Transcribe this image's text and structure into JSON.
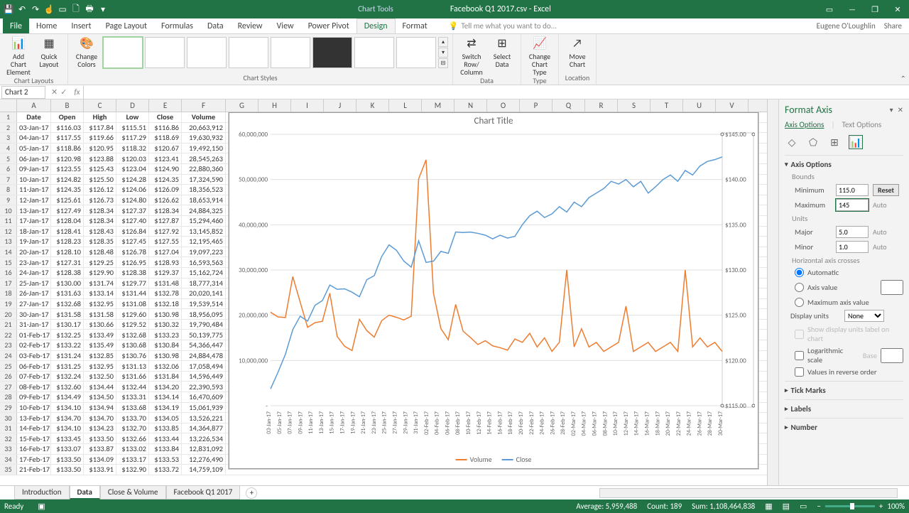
{
  "app": {
    "filename": "Facebook Q1 2017.csv - Excel",
    "context_tab": "Chart Tools",
    "user": "Eugene O'Loughlin",
    "share": "Share"
  },
  "qat": [
    "save",
    "undo",
    "redo",
    "touch",
    "new",
    "open",
    "quick-print",
    "more"
  ],
  "tabs": [
    "File",
    "Home",
    "Insert",
    "Page Layout",
    "Formulas",
    "Data",
    "Review",
    "View",
    "Power Pivot",
    "Design",
    "Format"
  ],
  "active_tab": "Design",
  "tellme": "Tell me what you want to do...",
  "ribbon": {
    "layouts": {
      "add": "Add Chart Element",
      "quick": "Quick Layout",
      "label": "Chart Layouts"
    },
    "colors": {
      "btn": "Change Colors",
      "styles_label": "Chart Styles"
    },
    "data": {
      "switch": "Switch Row/ Column",
      "select": "Select Data",
      "label": "Data"
    },
    "type": {
      "change": "Change Chart Type",
      "label": "Type"
    },
    "location": {
      "move": "Move Chart",
      "label": "Location"
    }
  },
  "namebox": "Chart 2",
  "columns": [
    "A",
    "B",
    "C",
    "D",
    "E",
    "F",
    "G",
    "H",
    "I",
    "J",
    "K",
    "L",
    "M",
    "N",
    "O",
    "P",
    "Q",
    "R",
    "S",
    "T",
    "U",
    "V"
  ],
  "col_widths": {
    "A": 48,
    "B": 46,
    "C": 46,
    "D": 46,
    "E": 46,
    "F": 62,
    "rest": 46
  },
  "headers": [
    "Date",
    "Open",
    "High",
    "Low",
    "Close",
    "Volume"
  ],
  "rows": [
    [
      "03-Jan-17",
      "$116.03",
      "$117.84",
      "$115.51",
      "$116.86",
      "20,663,912"
    ],
    [
      "04-Jan-17",
      "$117.55",
      "$119.66",
      "$117.29",
      "$118.69",
      "19,630,932"
    ],
    [
      "05-Jan-17",
      "$118.86",
      "$120.95",
      "$118.32",
      "$120.67",
      "19,492,150"
    ],
    [
      "06-Jan-17",
      "$120.98",
      "$123.88",
      "$120.03",
      "$123.41",
      "28,545,263"
    ],
    [
      "09-Jan-17",
      "$123.55",
      "$125.43",
      "$123.04",
      "$124.90",
      "22,880,360"
    ],
    [
      "10-Jan-17",
      "$124.82",
      "$125.50",
      "$124.28",
      "$124.35",
      "17,324,590"
    ],
    [
      "11-Jan-17",
      "$124.35",
      "$126.12",
      "$124.06",
      "$126.09",
      "18,356,523"
    ],
    [
      "12-Jan-17",
      "$125.61",
      "$126.73",
      "$124.80",
      "$126.62",
      "18,653,914"
    ],
    [
      "13-Jan-17",
      "$127.49",
      "$128.34",
      "$127.37",
      "$128.34",
      "24,884,325"
    ],
    [
      "17-Jan-17",
      "$128.04",
      "$128.34",
      "$127.40",
      "$127.87",
      "15,294,460"
    ],
    [
      "18-Jan-17",
      "$128.41",
      "$128.43",
      "$126.84",
      "$127.92",
      "13,145,852"
    ],
    [
      "19-Jan-17",
      "$128.23",
      "$128.35",
      "$127.45",
      "$127.55",
      "12,195,465"
    ],
    [
      "20-Jan-17",
      "$128.10",
      "$128.48",
      "$126.78",
      "$127.04",
      "19,097,223"
    ],
    [
      "23-Jan-17",
      "$127.31",
      "$129.25",
      "$126.95",
      "$128.93",
      "16,593,563"
    ],
    [
      "24-Jan-17",
      "$128.38",
      "$129.90",
      "$128.38",
      "$129.37",
      "15,162,724"
    ],
    [
      "25-Jan-17",
      "$130.00",
      "$131.74",
      "$129.77",
      "$131.48",
      "18,777,314"
    ],
    [
      "26-Jan-17",
      "$131.63",
      "$133.14",
      "$131.44",
      "$132.78",
      "20,020,141"
    ],
    [
      "27-Jan-17",
      "$132.68",
      "$132.95",
      "$131.08",
      "$132.18",
      "19,539,514"
    ],
    [
      "30-Jan-17",
      "$131.58",
      "$131.58",
      "$129.60",
      "$130.98",
      "18,956,095"
    ],
    [
      "31-Jan-17",
      "$130.17",
      "$130.66",
      "$129.52",
      "$130.32",
      "19,790,484"
    ],
    [
      "01-Feb-17",
      "$132.25",
      "$133.49",
      "$132.68",
      "$133.23",
      "50,139,775"
    ],
    [
      "02-Feb-17",
      "$133.22",
      "$135.49",
      "$130.68",
      "$130.84",
      "54,366,447"
    ],
    [
      "03-Feb-17",
      "$131.24",
      "$132.85",
      "$130.76",
      "$130.98",
      "24,884,478"
    ],
    [
      "06-Feb-17",
      "$131.25",
      "$132.95",
      "$131.13",
      "$132.06",
      "17,058,494"
    ],
    [
      "07-Feb-17",
      "$132.24",
      "$132.50",
      "$131.66",
      "$131.84",
      "14,596,449"
    ],
    [
      "08-Feb-17",
      "$132.60",
      "$134.44",
      "$132.44",
      "$134.20",
      "22,390,593"
    ],
    [
      "09-Feb-17",
      "$134.49",
      "$134.50",
      "$133.31",
      "$134.14",
      "16,470,609"
    ],
    [
      "10-Feb-17",
      "$134.10",
      "$134.94",
      "$133.68",
      "$134.19",
      "15,061,939"
    ],
    [
      "13-Feb-17",
      "$134.70",
      "$134.70",
      "$133.70",
      "$134.05",
      "13,526,221"
    ],
    [
      "14-Feb-17",
      "$134.10",
      "$134.23",
      "$132.70",
      "$133.85",
      "14,364,877"
    ],
    [
      "15-Feb-17",
      "$133.45",
      "$133.50",
      "$132.66",
      "$133.44",
      "13,226,534"
    ],
    [
      "16-Feb-17",
      "$133.07",
      "$133.87",
      "$133.02",
      "$133.84",
      "12,831,092"
    ],
    [
      "17-Feb-17",
      "$133.50",
      "$134.09",
      "$133.17",
      "$133.53",
      "12,276,490"
    ],
    [
      "21-Feb-17",
      "$133.50",
      "$133.91",
      "$132.90",
      "$133.72",
      "14,759,109"
    ]
  ],
  "chart": {
    "title": "Chart Title",
    "legend": [
      "Volume",
      "Close"
    ]
  },
  "chart_data": {
    "type": "line",
    "title": "Chart Title",
    "x_categories": [
      "03-Jan-17",
      "05-Jan-17",
      "07-Jan-17",
      "09-Jan-17",
      "11-Jan-17",
      "13-Jan-17",
      "15-Jan-17",
      "17-Jan-17",
      "19-Jan-17",
      "21-Jan-17",
      "23-Jan-17",
      "25-Jan-17",
      "27-Jan-17",
      "29-Jan-17",
      "31-Jan-17",
      "02-Feb-17",
      "04-Feb-17",
      "06-Feb-17",
      "08-Feb-17",
      "10-Feb-17",
      "12-Feb-17",
      "14-Feb-17",
      "16-Feb-17",
      "18-Feb-17",
      "20-Feb-17",
      "22-Feb-17",
      "24-Feb-17",
      "26-Feb-17",
      "28-Feb-17",
      "02-Mar-17",
      "04-Mar-17",
      "06-Mar-17",
      "08-Mar-17",
      "10-Mar-17",
      "12-Mar-17",
      "14-Mar-17",
      "16-Mar-17",
      "18-Mar-17",
      "20-Mar-17",
      "22-Mar-17",
      "24-Mar-17",
      "26-Mar-17",
      "28-Mar-17",
      "30-Mar-17"
    ],
    "primary_axis": {
      "label": "Volume",
      "min": 0,
      "max": 60000000,
      "major": 10000000,
      "ticks": [
        "-",
        "10,000,000",
        "20,000,000",
        "30,000,000",
        "40,000,000",
        "50,000,000",
        "60,000,000"
      ]
    },
    "secondary_axis": {
      "label": "Close",
      "min": 115,
      "max": 145,
      "major": 5,
      "ticks": [
        "$115.00",
        "$120.00",
        "$125.00",
        "$130.00",
        "$135.00",
        "$140.00",
        "$145.00"
      ]
    },
    "series": [
      {
        "name": "Volume",
        "axis": "primary",
        "color": "#ED7D31",
        "values": [
          20663912,
          19630932,
          19492150,
          28545263,
          22880360,
          17324590,
          18356523,
          18653914,
          24884325,
          15294460,
          13145852,
          12195465,
          19097223,
          16593563,
          15162724,
          18777314,
          20020141,
          19539514,
          18956095,
          19790484,
          50139775,
          54366447,
          24884478,
          17058494,
          14596449,
          22390593,
          16470609,
          15061939,
          13526221,
          14364877,
          13226534,
          12831092,
          12276490,
          14759109,
          14000000,
          16000000,
          13000000,
          15000000,
          12000000,
          14000000,
          30000000,
          13000000,
          17000000,
          13000000,
          14000000,
          12000000,
          13000000,
          14000000,
          22000000,
          12000000,
          13000000,
          14000000,
          12000000,
          13000000,
          14000000,
          12000000,
          30000000,
          13000000,
          15000000,
          13000000,
          14000000,
          12000000
        ]
      },
      {
        "name": "Close",
        "axis": "secondary",
        "color": "#5B9BD5",
        "values": [
          116.86,
          118.69,
          120.67,
          123.41,
          124.9,
          124.35,
          126.09,
          126.62,
          128.34,
          127.87,
          127.92,
          127.55,
          127.04,
          128.93,
          129.37,
          131.48,
          132.78,
          132.18,
          130.98,
          130.32,
          133.23,
          130.84,
          130.98,
          132.06,
          131.84,
          134.2,
          134.14,
          134.19,
          134.05,
          133.85,
          133.44,
          133.84,
          133.53,
          133.72,
          135.0,
          136.0,
          136.5,
          135.8,
          136.2,
          137.0,
          136.4,
          137.5,
          137.0,
          138.0,
          138.5,
          139.0,
          139.8,
          139.5,
          140.0,
          139.2,
          139.8,
          138.5,
          139.2,
          140.0,
          140.5,
          139.8,
          141.0,
          140.5,
          141.5,
          142.0,
          142.2,
          142.5
        ]
      }
    ]
  },
  "pane": {
    "title": "Format Axis",
    "tabs": [
      "Axis Options",
      "Text Options"
    ],
    "sections": {
      "axis_options": "Axis Options",
      "bounds": "Bounds",
      "min_l": "Minimum",
      "min_v": "115.0",
      "min_btn": "Reset",
      "max_l": "Maximum",
      "max_v": "145",
      "max_btn": "Auto",
      "units": "Units",
      "major_l": "Major",
      "major_v": "5.0",
      "major_btn": "Auto",
      "minor_l": "Minor",
      "minor_v": "1.0",
      "minor_btn": "Auto",
      "crosses": "Horizontal axis crosses",
      "auto": "Automatic",
      "axisval": "Axis value",
      "maxval": "Maximum axis value",
      "display_units": "Display units",
      "display_sel": "None",
      "show_label": "Show display units label on chart",
      "log": "Logarithmic scale",
      "base": "Base",
      "reverse": "Values in reverse order",
      "tick": "Tick Marks",
      "labels": "Labels",
      "number": "Number"
    }
  },
  "worksheets": [
    "Introduction",
    "Data",
    "Close & Volume",
    "Facebook Q1 2017"
  ],
  "active_ws": "Data",
  "status": {
    "ready": "Ready",
    "avg": "Average: 5,959,488",
    "count": "Count: 189",
    "sum": "Sum: 1,108,464,838",
    "zoom": "100%"
  }
}
